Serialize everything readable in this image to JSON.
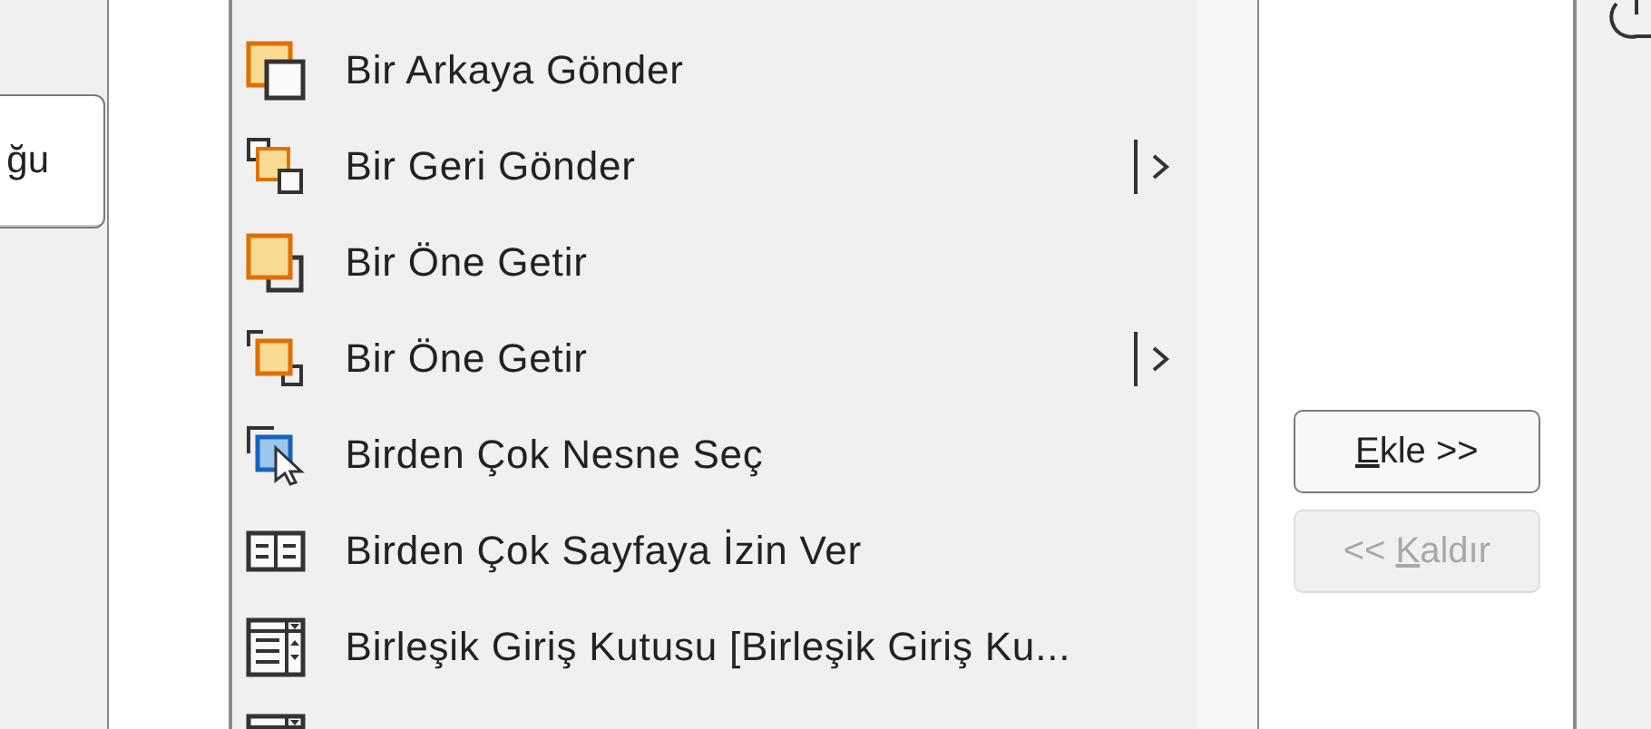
{
  "left_button": {
    "label": "ğu"
  },
  "commands": [
    {
      "label": "Bir Arkaya Gönder",
      "kind": "send-back",
      "submenu": false
    },
    {
      "label": "Bir Geri Gönder",
      "kind": "send-backward",
      "submenu": true
    },
    {
      "label": "Bir Öne Getir",
      "kind": "bring-front",
      "submenu": false
    },
    {
      "label": "Bir Öne Getir",
      "kind": "bring-forward",
      "submenu": true
    },
    {
      "label": "Birden Çok Nesne Seç",
      "kind": "select-objects",
      "submenu": false
    },
    {
      "label": "Birden Çok Sayfaya İzin Ver",
      "kind": "pages",
      "submenu": false
    },
    {
      "label": "Birleşik Giriş Kutusu [Birleşik Giriş Ku...",
      "kind": "combo",
      "submenu": false
    },
    {
      "kind": "combo",
      "submenu": false
    }
  ],
  "buttons": [
    {
      "underlined": "E",
      "rest": "kle >>",
      "disabled": false
    },
    {
      "before": "<< ",
      "underlined": "K",
      "rest": "aldır",
      "disabled": true
    }
  ]
}
